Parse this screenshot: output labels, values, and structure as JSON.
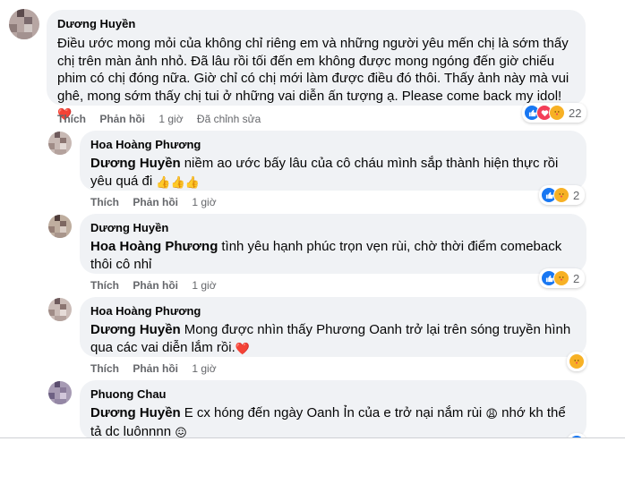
{
  "comments": [
    {
      "author": "Dương Huyền",
      "tag": "",
      "text": "Điều ước mong mỏi của không chỉ riêng em và những người yêu mến chị là sớm thấy chị trên màn ảnh nhỏ. Đã lâu rồi tối đến em không được mong ngóng đến giờ chiếu phim có chị đóng nữa. Giờ chỉ có chị mới làm được điều đó thôi. Thấy ảnh này mà vui ghê, mong sớm thấy chị tui ở những vai diễn ấn tượng ạ. Please come back my idol!",
      "emoji": "❤️",
      "like": "Thích",
      "reply": "Phản hồi",
      "time": "1 giờ",
      "edited": "Đã chỉnh sửa",
      "reactions": [
        "like-icon",
        "love-icon",
        "care-icon"
      ],
      "reaction_count": "22"
    },
    {
      "author": "Hoa Hoàng Phương",
      "tag": "Dương Huyền",
      "text": "niềm ao ước bấy lâu của cô cháu mình sắp thành hiện thực rồi yêu quá đi",
      "emoji": "👍👍👍",
      "like": "Thích",
      "reply": "Phản hồi",
      "time": "1 giờ",
      "reactions": [
        "like-icon",
        "care-icon"
      ],
      "reaction_count": "2"
    },
    {
      "author": "Dương Huyền",
      "tag": "Hoa Hoàng Phương",
      "text": "tình yêu hạnh phúc trọn vẹn rùi, chờ thời điểm comeback thôi cô nhỉ",
      "emoji": "",
      "like": "Thích",
      "reply": "Phản hồi",
      "time": "1 giờ",
      "reactions": [
        "like-icon",
        "care-icon"
      ],
      "reaction_count": "2"
    },
    {
      "author": "Hoa Hoàng Phương",
      "tag": "Dương Huyền",
      "text": "Mong được nhìn thấy Phương Oanh trở lại trên sóng truyền hình qua các vai diễn lắm rồi.",
      "emoji": "❤️",
      "like": "Thích",
      "reply": "Phản hồi",
      "time": "1 giờ",
      "reactions": [
        "care-icon"
      ],
      "reaction_count": ""
    },
    {
      "author": "Phuong Chau",
      "tag": "Dương Huyền",
      "text": "E cx hóng đến ngày Oanh Ỉn của e trở nại nắm rùi",
      "emoji": "😩",
      "text2": "nhớ kh thể tả dc luônnnn",
      "emoji2": "😖",
      "like": "Thích",
      "reply": "Phản hồi",
      "time": "1 giờ",
      "reactions": [
        "like-icon"
      ],
      "reaction_count": ""
    }
  ],
  "colors": {
    "bubble": "#f0f2f5",
    "like": "#1877f2",
    "love": "#f33e58",
    "care": "#f7b125",
    "meta_text": "#65676b"
  }
}
